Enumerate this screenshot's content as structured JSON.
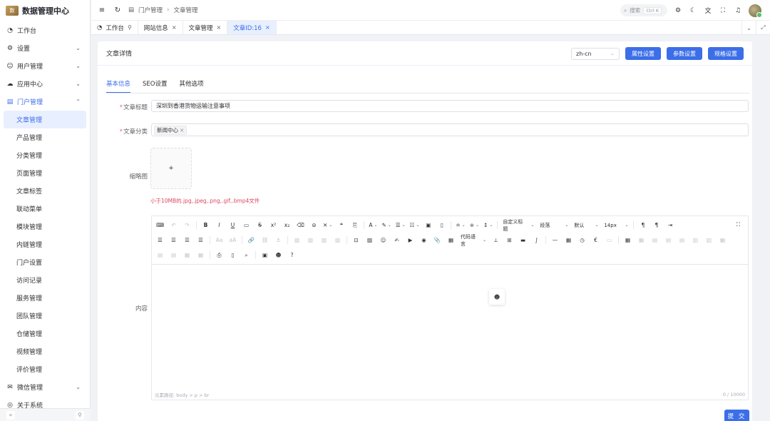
{
  "app": {
    "title": "数据管理中心",
    "logo_text": "数"
  },
  "sidebar": {
    "items": [
      {
        "icon": "dashboard-icon",
        "glyph": "◔",
        "label": "工作台",
        "arrow": ""
      },
      {
        "icon": "settings-icon",
        "glyph": "⚙",
        "label": "设置",
        "arrow": "⌄"
      },
      {
        "icon": "users-icon",
        "glyph": "👥",
        "label": "用户管理",
        "arrow": "⌄"
      },
      {
        "icon": "cloud-icon",
        "glyph": "☁",
        "label": "应用中心",
        "arrow": "⌄"
      },
      {
        "icon": "document-icon",
        "glyph": "▤",
        "label": "门户管理",
        "arrow": "⌃"
      }
    ],
    "portal_sub": [
      "文章管理",
      "产品管理",
      "分类管理",
      "页面管理",
      "文章标签",
      "联动菜单",
      "模块管理",
      "内链管理",
      "门户设置",
      "访问记录",
      "服务管理",
      "团队管理",
      "仓储管理",
      "视频管理",
      "评价管理"
    ],
    "tail_items": [
      {
        "label": "微信管理",
        "arrow": "⌄"
      },
      {
        "label": "关于系统",
        "arrow": ""
      }
    ],
    "footer": {
      "collapse": "«",
      "pin": "⚲"
    }
  },
  "header": {
    "breadcrumb": [
      "门户管理",
      "文章管理"
    ],
    "search": {
      "label": "搜索",
      "shortcut": "Ctrl K"
    }
  },
  "tabs": [
    {
      "label": "工作台",
      "closable": false,
      "active": false,
      "pin": "⚲"
    },
    {
      "label": "网站信息",
      "closable": true,
      "active": false
    },
    {
      "label": "文章管理",
      "closable": true,
      "active": false
    },
    {
      "label": "文章ID:16",
      "closable": true,
      "active": true
    }
  ],
  "card": {
    "title": "文章详情",
    "language": "zh-cn",
    "buttons": [
      "属性设置",
      "参数设置",
      "规格设置"
    ]
  },
  "inner_tabs": [
    "基本信息",
    "SEO设置",
    "其他选项"
  ],
  "form": {
    "title_label": "文章标题",
    "title_value": "深圳到香港货物运输注意事项",
    "category_label": "文章分类",
    "category_tag": "新闻中心",
    "thumbnail_label": "缩略图",
    "upload_plus": "+",
    "upload_hint": "小于10MB的.jpg,.jpeg,.png,.gif,.bmp4文件",
    "content_label": "内容",
    "submit": "提 交"
  },
  "editor": {
    "dropdowns": {
      "custom_title": "自定义标题",
      "paragraph": "段落",
      "font": "默认",
      "size": "14px",
      "code_lang": "代码语言"
    },
    "status_path": "元素路径: body > p > br",
    "counter": "0 / 10000"
  }
}
